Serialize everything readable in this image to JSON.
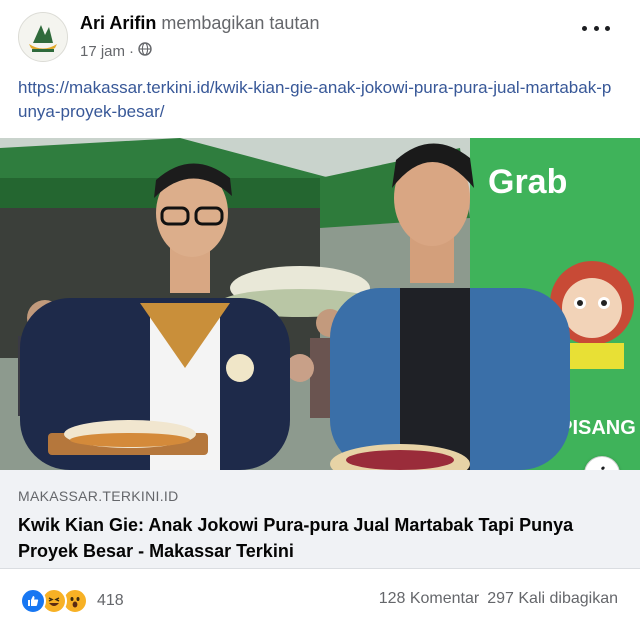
{
  "post": {
    "author": "Ari Arifin",
    "action": "membagikan tautan",
    "time": "17 jam",
    "audience_icon": "globe-icon",
    "more_icon": "more-options-icon",
    "link_text": "https://makassar.terkini.id/kwik-kian-gie-anak-jokowi-pura-pura-jual-martabak-punya-proyek-besar/"
  },
  "link_card": {
    "domain": "MAKASSAR.TERKINI.ID",
    "title": "Kwik Kian Gie: Anak Jokowi Pura-pura Jual Martabak Tapi Punya Proyek Besar - Makassar Terkini",
    "info_icon": "info-icon",
    "banner_text": "Grab",
    "banner_text_2": "G PISANG"
  },
  "footer": {
    "reactions": [
      "like-icon",
      "haha-icon",
      "wow-icon"
    ],
    "reaction_count": "418",
    "comments": "128 Komentar",
    "shares": "297 Kali dibagikan"
  },
  "colors": {
    "link": "#385898",
    "secondary_text": "#65676b",
    "card_background": "#f0f2f5",
    "like_blue": "#1877f2",
    "reaction_yellow": "#f7b125"
  }
}
